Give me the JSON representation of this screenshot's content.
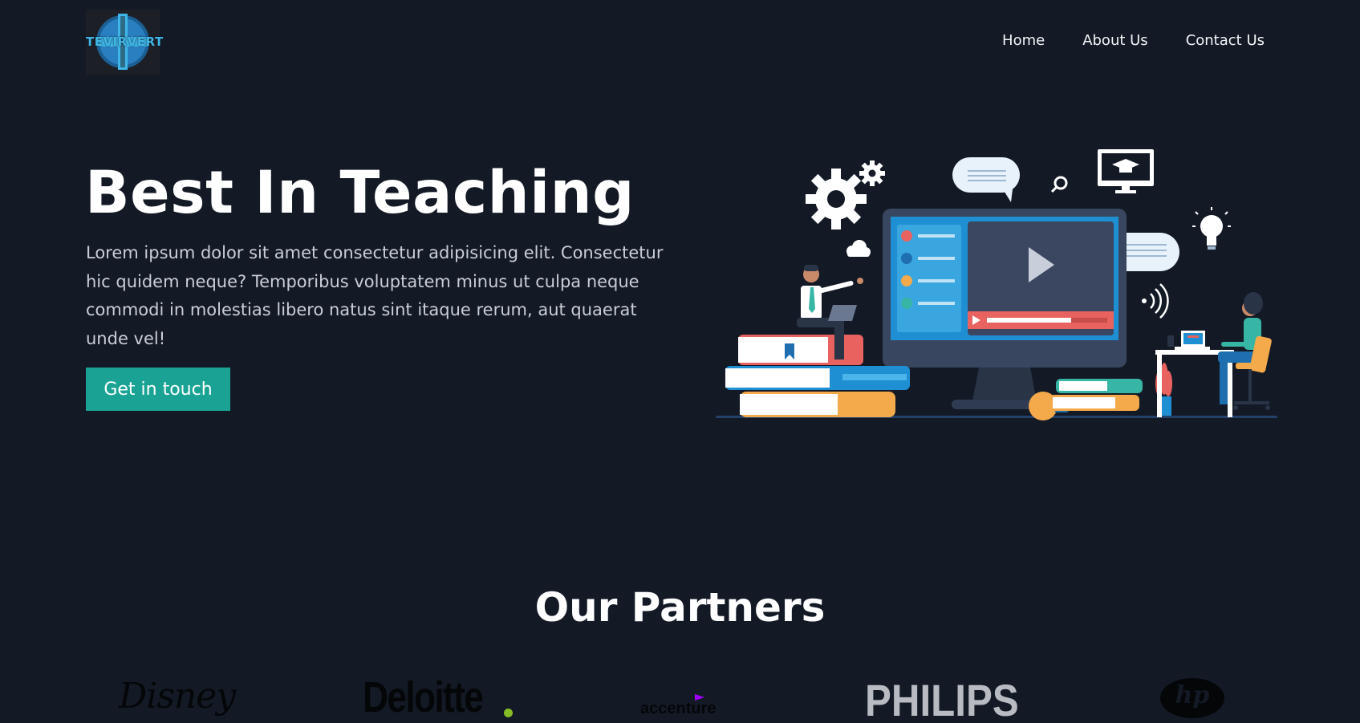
{
  "header": {
    "logo_text": "TEVIRVERT",
    "nav": [
      {
        "label": "Home"
      },
      {
        "label": "About Us"
      },
      {
        "label": "Contact Us"
      }
    ]
  },
  "hero": {
    "title": "Best In Teaching",
    "text": "Lorem ipsum dolor sit amet consectetur adipisicing elit. Consectetur hic quidem neque? Temporibus voluptatem minus ut culpa neque commodi in molestias libero natus sint itaque rerum, aut quaerat unde vel!",
    "cta_label": "Get in touch"
  },
  "partners": {
    "title": "Our Partners",
    "logos": [
      {
        "name": "Disney",
        "text": "Disney"
      },
      {
        "name": "Deloitte",
        "text": "Deloitte"
      },
      {
        "name": "Accenture",
        "text": "accenture"
      },
      {
        "name": "Philips",
        "text": "PHILIPS"
      },
      {
        "name": "HP",
        "text": "hp"
      }
    ]
  },
  "colors": {
    "background": "#131a26",
    "accent": "#1aa394",
    "logo_blue": "#3fb6e8"
  }
}
